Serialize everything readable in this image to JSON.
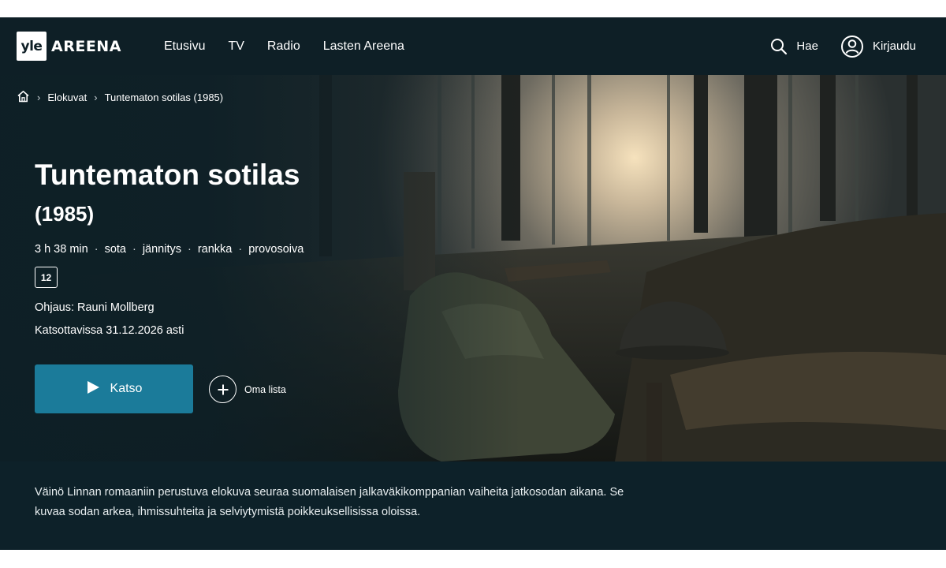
{
  "brand": {
    "logo_mark": "yle",
    "logo_text": "AREENA"
  },
  "nav": {
    "items": [
      {
        "label": "Etusivu"
      },
      {
        "label": "TV"
      },
      {
        "label": "Radio"
      },
      {
        "label": "Lasten Areena"
      }
    ]
  },
  "header_actions": {
    "search_label": "Hae",
    "search_icon": "search-icon",
    "login_label": "Kirjaudu",
    "login_icon": "user-icon"
  },
  "breadcrumb": {
    "home_icon": "home-icon",
    "items": [
      "Elokuvat",
      "Tuntematon sotilas (1985)"
    ]
  },
  "program": {
    "title": "Tuntematon sotilas",
    "year": "(1985)",
    "meta": [
      "3 h 38 min",
      "sota",
      "jännitys",
      "rankka",
      "provosoiva"
    ],
    "meta_separator": "·",
    "age_rating": "12",
    "director": "Ohjaus: Rauni Mollberg",
    "available": "Katsottavissa 31.12.2026 asti",
    "watch_label": "Katso",
    "mylist_label": "Oma lista",
    "description": "Väinö Linnan romaaniin perustuva elokuva seuraa suomalaisen jalkaväkikomppanian vaiheita jatkosodan aikana. Se kuvaa sodan arkea, ihmissuhteita ja selviytymistä poikkeuksellisissa oloissa."
  },
  "colors": {
    "header_bg": "#0e1f26",
    "page_bg": "#0d2129",
    "accent": "#1b7b9a"
  }
}
